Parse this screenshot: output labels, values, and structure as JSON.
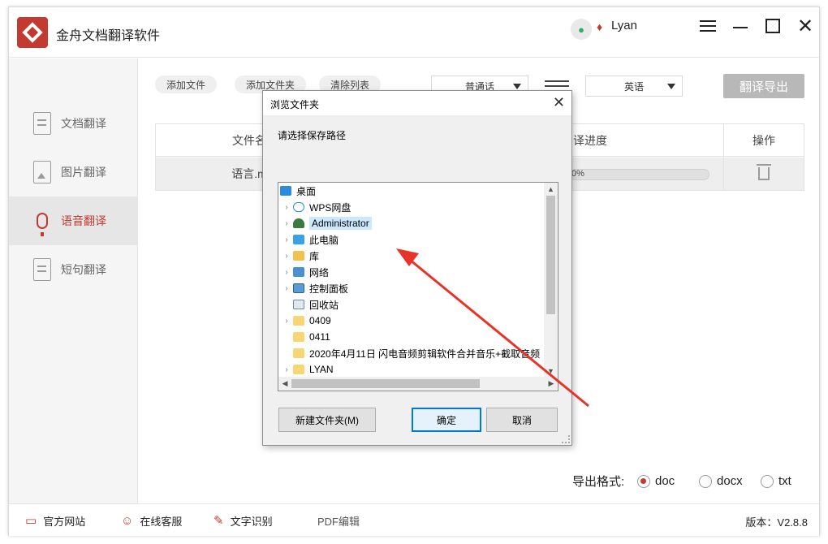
{
  "app": {
    "title": "金舟文档翻译软件",
    "username": "Lyan"
  },
  "colors": {
    "brand": "#c23a30",
    "selection": "#cce8ff",
    "primary_border": "#0078d7"
  },
  "sidebar": {
    "items": [
      {
        "label": "文档翻译",
        "icon": "document-icon",
        "active": false
      },
      {
        "label": "图片翻译",
        "icon": "image-icon",
        "active": false
      },
      {
        "label": "语音翻译",
        "icon": "microphone-icon",
        "active": true
      },
      {
        "label": "短句翻译",
        "icon": "sentence-icon",
        "active": false
      }
    ]
  },
  "toolbar": {
    "add_file": "添加文件",
    "add_folder": "添加文件夹",
    "clear_list": "清除列表",
    "source_lang": "普通话",
    "target_lang": "英语",
    "export_label": "翻译导出"
  },
  "table": {
    "headers": {
      "filename": "文件名",
      "progress": "译进度",
      "action": "操作"
    },
    "rows": [
      {
        "filename": "语言.m",
        "progress": "0%",
        "progress_value": 0
      }
    ]
  },
  "export": {
    "label": "导出格式:",
    "options": [
      {
        "label": "doc",
        "selected": true
      },
      {
        "label": "docx",
        "selected": false
      },
      {
        "label": "txt",
        "selected": false
      }
    ]
  },
  "footer": {
    "official_site": "官方网站",
    "online_service": "在线客服",
    "ocr": "文字识别",
    "pdf_edit": "PDF编辑",
    "version": "版本：V2.8.8"
  },
  "dialog": {
    "title": "浏览文件夹",
    "prompt": "请选择保存路径",
    "tree": [
      {
        "label": "桌面",
        "icon": "desktop-icon",
        "expandable": false,
        "indent": 0,
        "selected": false
      },
      {
        "label": "WPS网盘",
        "icon": "cloud-icon",
        "expandable": true,
        "indent": 1,
        "selected": false
      },
      {
        "label": "Administrator",
        "icon": "user-icon",
        "expandable": true,
        "indent": 1,
        "selected": true
      },
      {
        "label": "此电脑",
        "icon": "computer-icon",
        "expandable": true,
        "indent": 1,
        "selected": false
      },
      {
        "label": "库",
        "icon": "library-icon",
        "expandable": true,
        "indent": 1,
        "selected": false
      },
      {
        "label": "网络",
        "icon": "network-icon",
        "expandable": true,
        "indent": 1,
        "selected": false
      },
      {
        "label": "控制面板",
        "icon": "control-panel-icon",
        "expandable": true,
        "indent": 1,
        "selected": false
      },
      {
        "label": "回收站",
        "icon": "recycle-bin-icon",
        "expandable": false,
        "indent": 1,
        "selected": false
      },
      {
        "label": "0409",
        "icon": "folder-icon",
        "expandable": true,
        "indent": 1,
        "selected": false
      },
      {
        "label": "0411",
        "icon": "folder-icon",
        "expandable": false,
        "indent": 1,
        "selected": false
      },
      {
        "label": "2020年4月11日 闪电音频剪辑软件合并音乐+截取音频",
        "icon": "folder-icon",
        "expandable": false,
        "indent": 1,
        "selected": false
      },
      {
        "label": "LYAN",
        "icon": "folder-icon",
        "expandable": true,
        "indent": 1,
        "selected": false
      }
    ],
    "new_folder": "新建文件夹(M)",
    "ok": "确定",
    "cancel": "取消"
  }
}
